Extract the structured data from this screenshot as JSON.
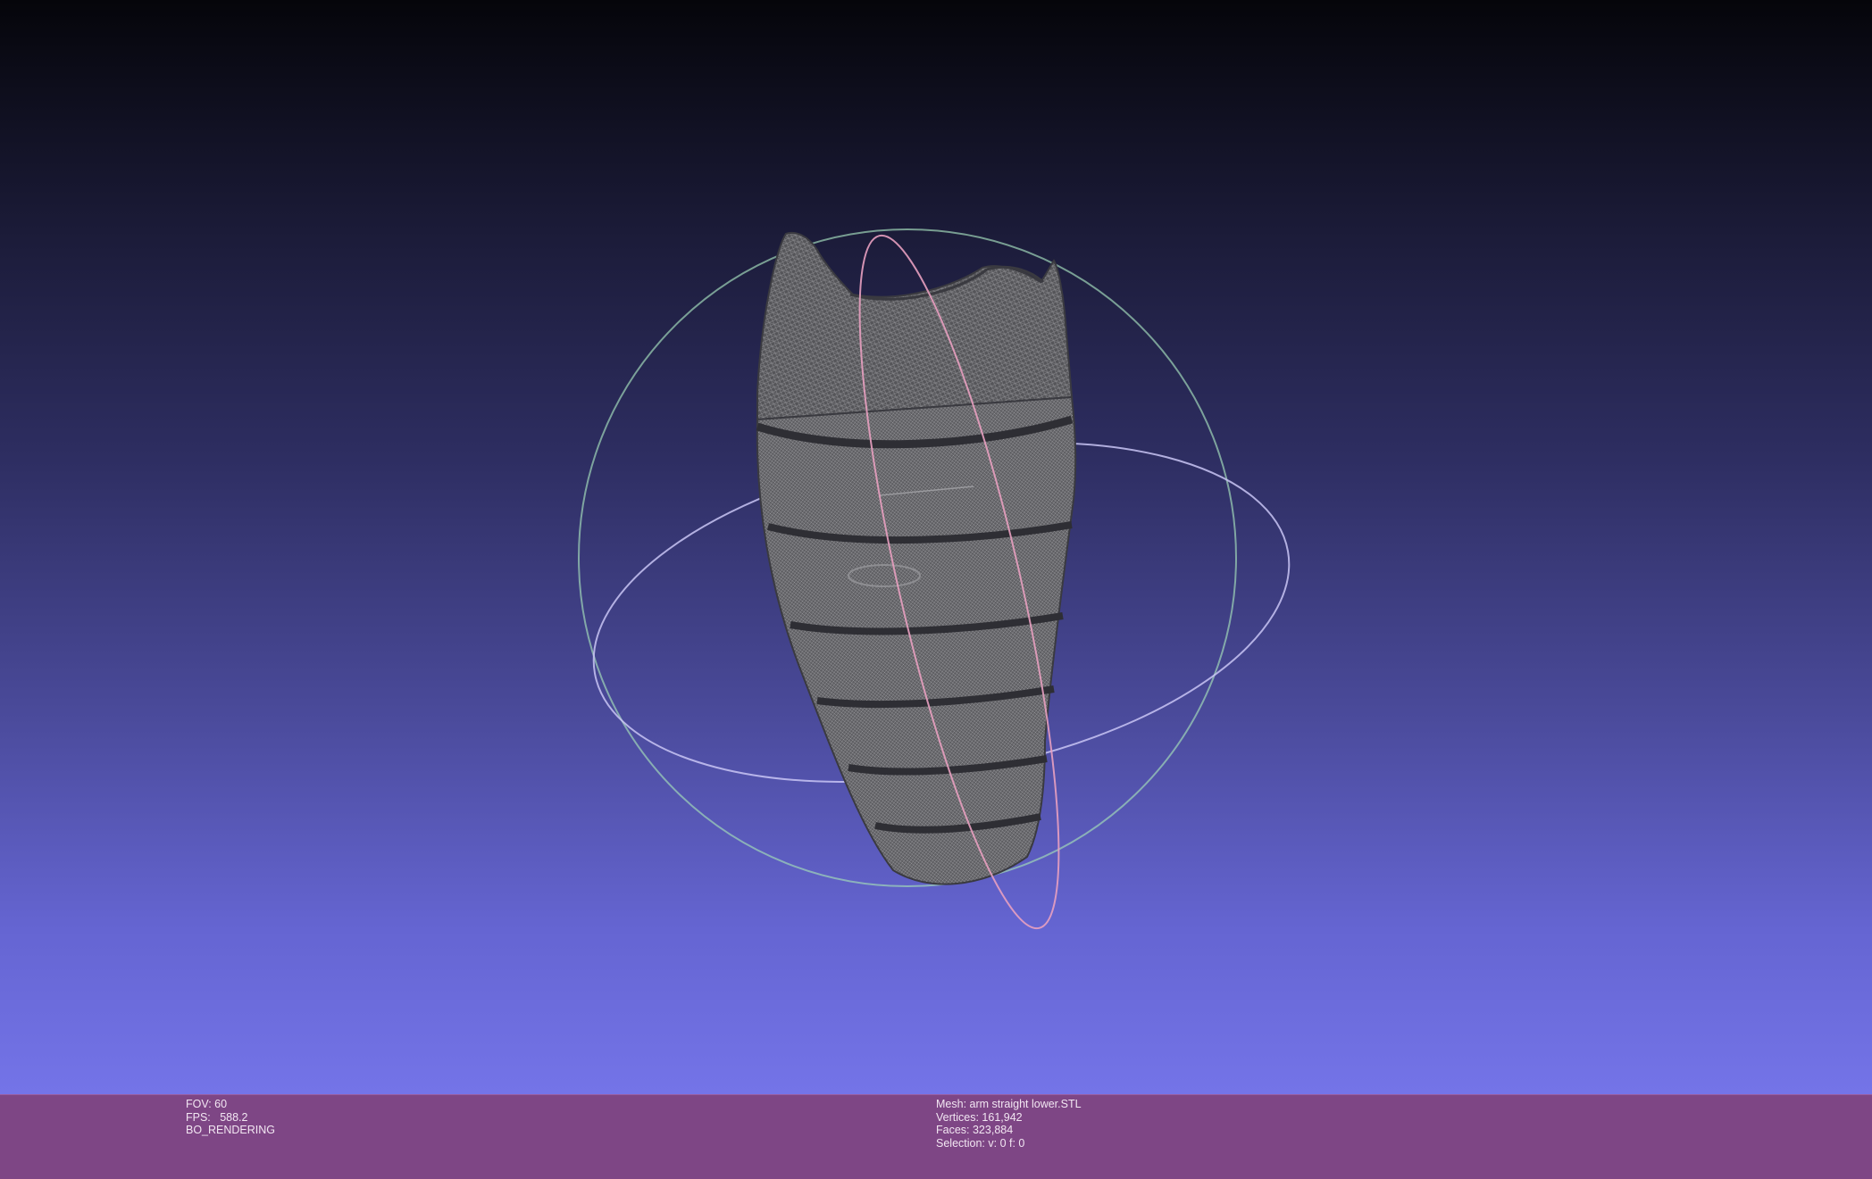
{
  "viewport": {
    "background_top": "#05050a",
    "background_bottom": "#7474e8",
    "mesh_color": "#6e6e6e",
    "trackball_colors": {
      "horizontal_ring": "#c9c6f4",
      "vertical_ring": "#e8a0c0",
      "outer_ring": "#9fd6b8"
    }
  },
  "status_left": {
    "fov": "FOV: 60",
    "fps": "FPS:   588.2",
    "mode": "BO_RENDERING"
  },
  "status_right": {
    "mesh": "Mesh: arm straight lower.STL",
    "vertices": "Vertices: 161,942",
    "faces": "Faces: 323,884",
    "selection": "Selection: v: 0 f: 0"
  },
  "statusbar_color": "#7e4685"
}
